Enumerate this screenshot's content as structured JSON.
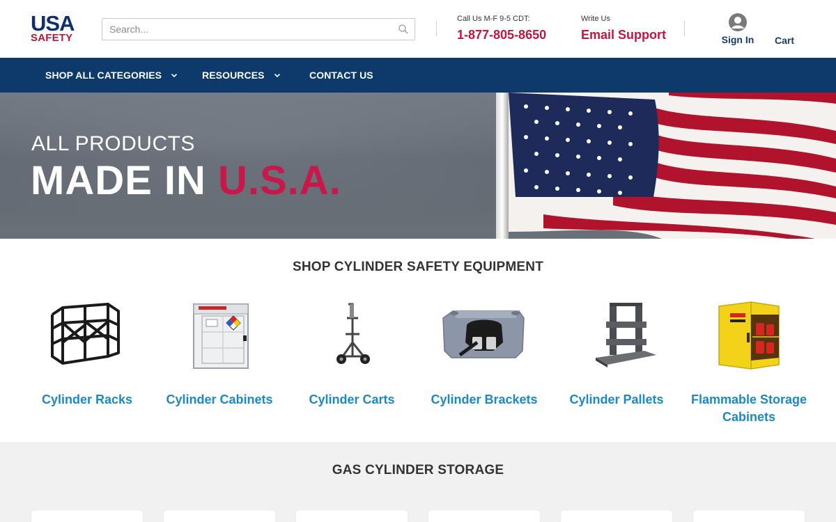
{
  "header": {
    "logo_top": "USA",
    "logo_bottom": "SAFETY",
    "search_placeholder": "Search...",
    "call_label": "Call Us M-F 9-5 CDT:",
    "phone": "1-877-805-8650",
    "write_label": "Write Us",
    "email_label": "Email Support",
    "signin_label": "Sign In",
    "cart_label": "Cart"
  },
  "nav": {
    "items": [
      {
        "label": "SHOP ALL CATEGORIES",
        "has_dropdown": true
      },
      {
        "label": "RESOURCES",
        "has_dropdown": true
      },
      {
        "label": "CONTACT US",
        "has_dropdown": false
      }
    ]
  },
  "hero": {
    "line1": "ALL PRODUCTS",
    "line2_prefix": "MADE IN ",
    "line2_accent": "U.S.A."
  },
  "section1": {
    "title": "SHOP CYLINDER SAFETY EQUIPMENT",
    "categories": [
      {
        "label": "Cylinder Racks",
        "icon": "cylinder-rack-image"
      },
      {
        "label": "Cylinder Cabinets",
        "icon": "cylinder-cabinet-image"
      },
      {
        "label": "Cylinder Carts",
        "icon": "cylinder-cart-image"
      },
      {
        "label": "Cylinder Brackets",
        "icon": "cylinder-bracket-image"
      },
      {
        "label": "Cylinder Pallets",
        "icon": "cylinder-pallet-image"
      },
      {
        "label": "Flammable Storage Cabinets",
        "icon": "flammable-cabinet-image"
      }
    ]
  },
  "section2": {
    "title": "GAS CYLINDER STORAGE"
  },
  "colors": {
    "brand_navy": "#0e3a6b",
    "brand_red": "#c3163f",
    "link_blue": "#1c88c4"
  }
}
